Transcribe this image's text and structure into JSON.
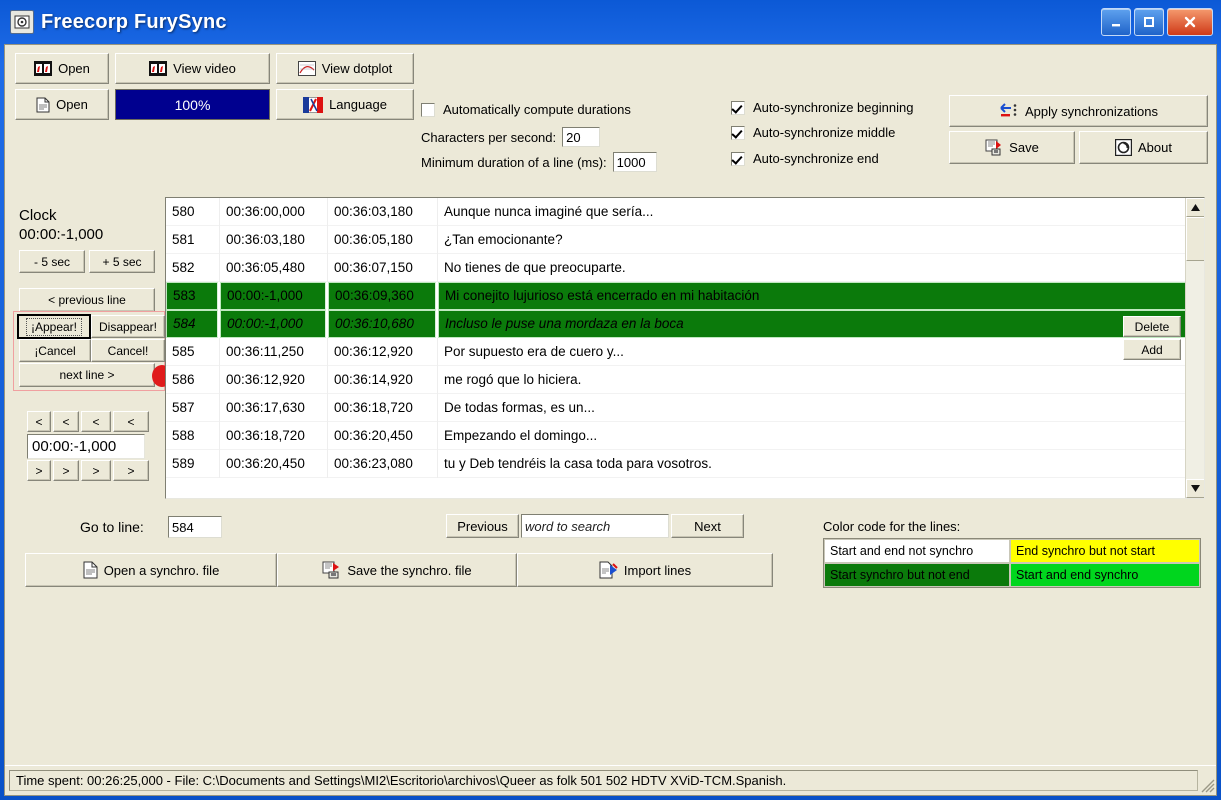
{
  "window": {
    "title": "Freecorp FurySync",
    "icon": "app-film-icon",
    "buttons": {
      "minimize": "minimize-icon",
      "maximize": "maximize-icon",
      "close": "close-icon"
    },
    "titlebar_color": "#0a52c8"
  },
  "toolbar": {
    "open_video": "Open",
    "view_video": "View video",
    "view_dotplot": "View dotplot",
    "open_text": "Open",
    "progress": "100%",
    "progress_color": "#00008f",
    "language": "Language",
    "auto_durations_label": "Automatically compute durations",
    "auto_durations_checked": false,
    "chars_per_second_label": "Characters per second:",
    "chars_per_second_value": "20",
    "min_duration_label": "Minimum duration of a line (ms):",
    "min_duration_value": "1000",
    "sync_beginning_label": "Auto-synchronize beginning",
    "sync_middle_label": "Auto-synchronize middle",
    "sync_end_label": "Auto-synchronize end",
    "apply_label": "Apply synchronizations",
    "save_label": "Save",
    "about_label": "About"
  },
  "left_panel": {
    "clock_label": "Clock",
    "clock_value": "00:00:-1,000",
    "minus5": "- 5 sec",
    "plus5": "+ 5 sec",
    "previous_line": "< previous line",
    "appear": "¡Appear!",
    "disappear": "Disappear!",
    "cancel_start": "¡Cancel",
    "cancel_end": "Cancel!",
    "next_line": "next line >",
    "time_value": "00:00:-1,000",
    "nav_prev": [
      "<",
      "<",
      "<",
      "<"
    ],
    "nav_next": [
      ">",
      ">",
      ">",
      ">"
    ],
    "nav_prev_widths": [
      24,
      26,
      30,
      36
    ],
    "nav_next_widths": [
      24,
      26,
      30,
      36
    ]
  },
  "list": {
    "floating": {
      "delete": "Delete",
      "add": "Add"
    },
    "rows": [
      {
        "num": "580",
        "start": "00:36:00,000",
        "end": "00:36:03,180",
        "text": "Aunque nunca imaginé que sería...",
        "state": "normal"
      },
      {
        "num": "581",
        "start": "00:36:03,180",
        "end": "00:36:05,180",
        "text": "¿Tan emocionante?",
        "state": "normal"
      },
      {
        "num": "582",
        "start": "00:36:05,480",
        "end": "00:36:07,150",
        "text": "No tienes de que preocuparte.",
        "state": "normal"
      },
      {
        "num": "583",
        "start": "00:00:-1,000",
        "end": "00:36:09,360",
        "text": "Mi conejito lujurioso está encerrado en mi habitación",
        "state": "green"
      },
      {
        "num": "584",
        "start": "00:00:-1,000",
        "end": "00:36:10,680",
        "text": "Incluso le puse una mordaza en la boca",
        "state": "green-italic"
      },
      {
        "num": "585",
        "start": "00:36:11,250",
        "end": "00:36:12,920",
        "text": "Por supuesto era de cuero y...",
        "state": "normal"
      },
      {
        "num": "586",
        "start": "00:36:12,920",
        "end": "00:36:14,920",
        "text": "me rogó que lo hiciera.",
        "state": "normal"
      },
      {
        "num": "587",
        "start": "00:36:17,630",
        "end": "00:36:18,720",
        "text": "De todas formas, es un...",
        "state": "normal"
      },
      {
        "num": "588",
        "start": "00:36:18,720",
        "end": "00:36:20,450",
        "text": "Empezando el domingo...",
        "state": "normal"
      },
      {
        "num": "589",
        "start": "00:36:20,450",
        "end": "00:36:23,080",
        "text": "tu y Deb tendréis la casa toda para vosotros.",
        "state": "normal"
      }
    ]
  },
  "bottom": {
    "goto_line_label": "Go to line:",
    "goto_line_value": "584",
    "previous_label": "Previous",
    "search_placeholder": "word to search",
    "next_label": "Next",
    "open_synchro": "Open a synchro. file",
    "save_synchro": "Save the synchro. file",
    "import_lines": "Import lines"
  },
  "legend": {
    "title": "Color code for the lines:",
    "cells": [
      {
        "label": "Start and end not synchro",
        "bg": "#ffffff",
        "fg": "#000000"
      },
      {
        "label": "End synchro but not start",
        "bg": "#ffff00",
        "fg": "#000000"
      },
      {
        "label": "Start synchro but not end",
        "bg": "#0b7a0b",
        "fg": "#000000"
      },
      {
        "label": "Start and end synchro",
        "bg": "#00d61e",
        "fg": "#000000"
      }
    ]
  },
  "statusbar": {
    "text": "Time spent: 00:26:25,000 - File: C:\\Documents and Settings\\MI2\\Escritorio\\archivos\\Queer as folk 501 502 HDTV XViD-TCM.Spanish."
  }
}
